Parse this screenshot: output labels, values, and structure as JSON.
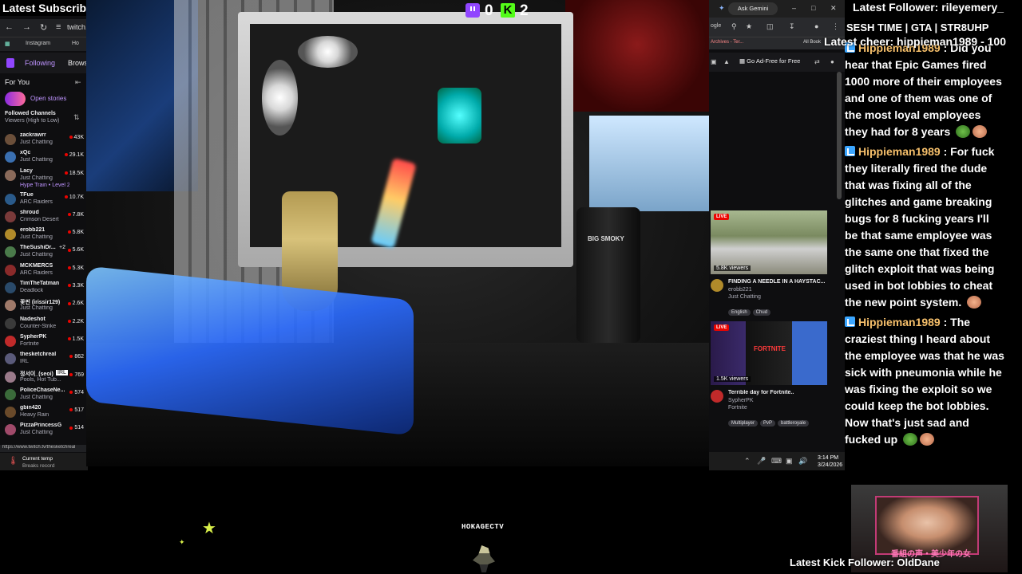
{
  "overlay": {
    "latest_subscriber": "Latest Subscrib",
    "latest_follower": "Latest Follower: rileyemery_",
    "latest_cheer": "Latest cheer: hippieman1989 - 100",
    "stream_title": "SESH TIME | GTA | STR8UHP",
    "latest_kick_follower": "Latest Kick Follower: OldDane",
    "bottom_banner": "HOKAGECTV",
    "twitch_count": "0",
    "kick_count": "2",
    "kick_letter": "K",
    "cam_caption": "番組の声・美少年の女"
  },
  "left_browser": {
    "url": "twitch.",
    "bookmarks": [
      "Instagram",
      "Ho"
    ],
    "nav": {
      "following": "Following",
      "browse": "Brows"
    },
    "for_you": "For You",
    "open_stories": "Open stories",
    "followed_header": "Followed Channels",
    "followed_sort": "Viewers (High to Low)",
    "channels": [
      {
        "name": "zackrawrr",
        "game": "Just Chatting",
        "viewers": "43K",
        "color": "#6b4f3a"
      },
      {
        "name": "xQc",
        "game": "Just Chatting",
        "viewers": "29.1K",
        "color": "#3a6fb0"
      },
      {
        "name": "Lacy",
        "game": "Just Chatting",
        "viewers": "18.5K",
        "color": "#8a6a5a"
      },
      {
        "name": "TFue",
        "game": "ARC Raiders",
        "viewers": "10.7K",
        "color": "#2a5a8a"
      },
      {
        "name": "shroud",
        "game": "Crimson Desert",
        "viewers": "7.8K",
        "color": "#7a3a3a"
      },
      {
        "name": "erobb221",
        "game": "Just Chatting",
        "viewers": "5.8K",
        "color": "#b08a2a"
      },
      {
        "name": "TheSushiDr...",
        "game": "Just Chatting",
        "viewers": "5.6K",
        "color": "#4a7a4a"
      },
      {
        "name": "MCKMERCS",
        "game": "ARC Raiders",
        "viewers": "5.3K",
        "color": "#8a2a2a"
      },
      {
        "name": "TimTheTatman",
        "game": "Deadlock",
        "viewers": "3.3K",
        "color": "#2a4a6a"
      },
      {
        "name": "꽃핀 (irissir129)",
        "game": "Just Chatting",
        "viewers": "2.6K",
        "color": "#a07a6a"
      },
      {
        "name": "Nadeshot",
        "game": "Counter-Strike",
        "viewers": "2.2K",
        "color": "#3a3a3a"
      },
      {
        "name": "SypherPK",
        "game": "Fortnite",
        "viewers": "1.5K",
        "color": "#c02a2a"
      },
      {
        "name": "thesketchreal",
        "game": "IRL",
        "viewers": "862",
        "color": "#5a5a7a"
      },
      {
        "name": "정서이_(seoi)",
        "game": "Pools, Hot Tub...",
        "viewers": "769",
        "color": "#9a7a8a"
      },
      {
        "name": "PoliceChaseNe...",
        "game": "Just Chatting",
        "viewers": "574",
        "color": "#3a6a3a"
      },
      {
        "name": "gbin420",
        "game": "Heavy Rain",
        "viewers": "517",
        "color": "#6a4a2a"
      },
      {
        "name": "PizzaPrincessG",
        "game": "Just Chatting",
        "viewers": "514",
        "color": "#a04a6a"
      }
    ],
    "hype_train": "Hype Train • Level 2",
    "sushi_extra": "+2",
    "tooltip_irl": "IRL",
    "status_url": "https://www.twitch.tv/thesketchreal",
    "weather": {
      "title": "Current temp",
      "subtitle": "Breaks record"
    }
  },
  "right_browser": {
    "ask_gemini": "Ask Gemini",
    "address_prefix": "ogle",
    "bookmarks": [
      "Archives - Ter...",
      "All Book"
    ],
    "ad_free": "Go Ad-Free for Free",
    "cards": [
      {
        "viewers": "5.8K viewers",
        "live": "LIVE",
        "title": "FINDING A NEEDLE IN A HAYSTAC...",
        "channel": "erobb221",
        "game": "Just Chatting",
        "tags": [
          "English",
          "Chud"
        ],
        "avatar_color": "#b08a2a"
      },
      {
        "viewers": "1.5K viewers",
        "live": "LIVE",
        "title": "Terrible day for Fortnite..",
        "channel": "SypherPK",
        "game": "Fortnite",
        "tags": [
          "Multiplayer",
          "PvP",
          "battleroyale"
        ],
        "avatar_color": "#c02a2a"
      }
    ],
    "thumb_fortnite_label": "FORTNITE",
    "tray_time": "3:14 PM",
    "tray_date": "3/24/2026"
  },
  "webcam": {
    "can_label": "BIG SMOKY"
  },
  "chat": {
    "messages": [
      {
        "user": "Hippieman1989",
        "text": " : Did you hear that Epic Games fired 1000 more of their employees and one of them was one of the most loyal employees they had for 8 years",
        "emotes": [
          "frog",
          "face"
        ]
      },
      {
        "user": "Hippieman1989",
        "text": " : For fuck they literally fired the dude that was fixing all of the glitches and game breaking bugs for 8 fucking years I'll be that same employee was the same one that fixed the glitch exploit that was being used in bot lobbies to cheat the new point system.",
        "emotes": [
          "face"
        ]
      },
      {
        "user": "Hippieman1989",
        "text": " : The craziest thing I heard about the employee was that he was sick with pneumonia while he was fixing the exploit so we could keep the bot lobbies. Now that's just sad and fucked up",
        "emotes": [
          "frog",
          "face"
        ]
      }
    ],
    "first_user_partial": "Hippieman1989"
  }
}
